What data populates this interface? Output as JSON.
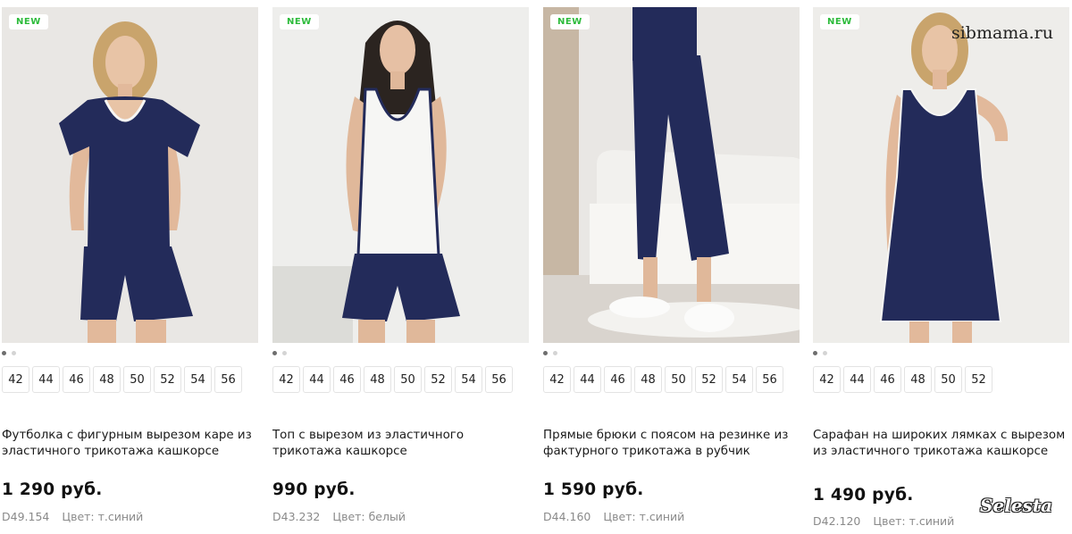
{
  "watermarks": {
    "site": "sibmama.ru",
    "brand": "Selesta"
  },
  "colors": {
    "badge_text": "#2dbb3b",
    "garment_navy": "#232b5a",
    "garment_white": "#f6f6f4"
  },
  "products": [
    {
      "badge": "NEW",
      "image_icon": "model-navy-tshirt-shorts",
      "dots_total": 2,
      "dots_active": 1,
      "sizes": [
        "42",
        "44",
        "46",
        "48",
        "50",
        "52",
        "54",
        "56"
      ],
      "title": "Футболка с фигурным вырезом каре из эластичного трикотажа кашкорсе",
      "price": "1 290 руб.",
      "sku": "D49.154",
      "color": "Цвет: т.синий"
    },
    {
      "badge": "NEW",
      "image_icon": "model-white-top-navy-shorts",
      "dots_total": 2,
      "dots_active": 1,
      "sizes": [
        "42",
        "44",
        "46",
        "48",
        "50",
        "52",
        "54",
        "56"
      ],
      "title": "Топ с вырезом из эластичного трикотажа кашкорсе",
      "price": "990 руб.",
      "sku": "D43.232",
      "color": "Цвет: белый"
    },
    {
      "badge": "NEW",
      "image_icon": "model-navy-trousers-slippers",
      "dots_total": 2,
      "dots_active": 1,
      "sizes": [
        "42",
        "44",
        "46",
        "48",
        "50",
        "52",
        "54",
        "56"
      ],
      "title": "Прямые брюки с поясом на резинке из фактурного трикотажа в рубчик",
      "price": "1 590 руб.",
      "sku": "D44.160",
      "color": "Цвет: т.синий"
    },
    {
      "badge": "NEW",
      "image_icon": "model-navy-sundress",
      "dots_total": 2,
      "dots_active": 1,
      "sizes": [
        "42",
        "44",
        "46",
        "48",
        "50",
        "52"
      ],
      "title": "Сарафан на широких лямках с вырезом из эластичного трикотажа кашкорсе",
      "price": "1 490 руб.",
      "sku": "D42.120",
      "color": "Цвет: т.синий"
    }
  ]
}
